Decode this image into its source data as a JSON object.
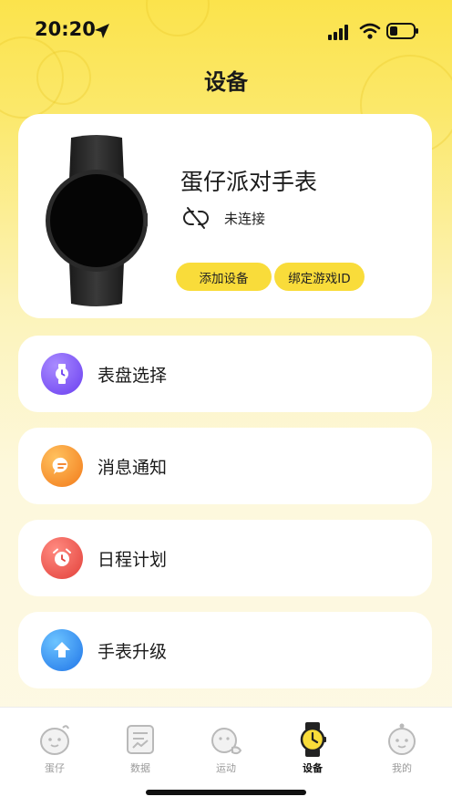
{
  "status_bar": {
    "time": "20:20",
    "location_icon": "location-arrow-icon",
    "signal_icon": "cellular-signal-icon",
    "wifi_icon": "wifi-icon",
    "battery_icon": "battery-low-icon"
  },
  "page": {
    "title": "设备"
  },
  "device_card": {
    "image_icon": "smartwatch-image",
    "name": "蛋仔派对手表",
    "status_icon": "link-broken-icon",
    "status_text": "未连接",
    "add_device_label": "添加设备",
    "bind_game_id_label": "绑定游戏ID"
  },
  "menu": [
    {
      "label": "表盘选择",
      "icon": "watch-face-icon",
      "color": "#7a4cf5"
    },
    {
      "label": "消息通知",
      "icon": "message-bubble-icon",
      "color": "#f48a25"
    },
    {
      "label": "日程计划",
      "icon": "alarm-clock-icon",
      "color": "#e8504a"
    },
    {
      "label": "手表升级",
      "icon": "upgrade-arrow-icon",
      "color": "#2b86f0"
    }
  ],
  "tab_bar": {
    "tabs": [
      {
        "label": "蛋仔",
        "icon": "eggy-character-icon",
        "active": false
      },
      {
        "label": "数据",
        "icon": "data-report-icon",
        "active": false
      },
      {
        "label": "运动",
        "icon": "sport-runner-icon",
        "active": false
      },
      {
        "label": "设备",
        "icon": "watch-device-icon",
        "active": true
      },
      {
        "label": "我的",
        "icon": "profile-face-icon",
        "active": false
      }
    ],
    "accent": "#f9dc3a"
  }
}
